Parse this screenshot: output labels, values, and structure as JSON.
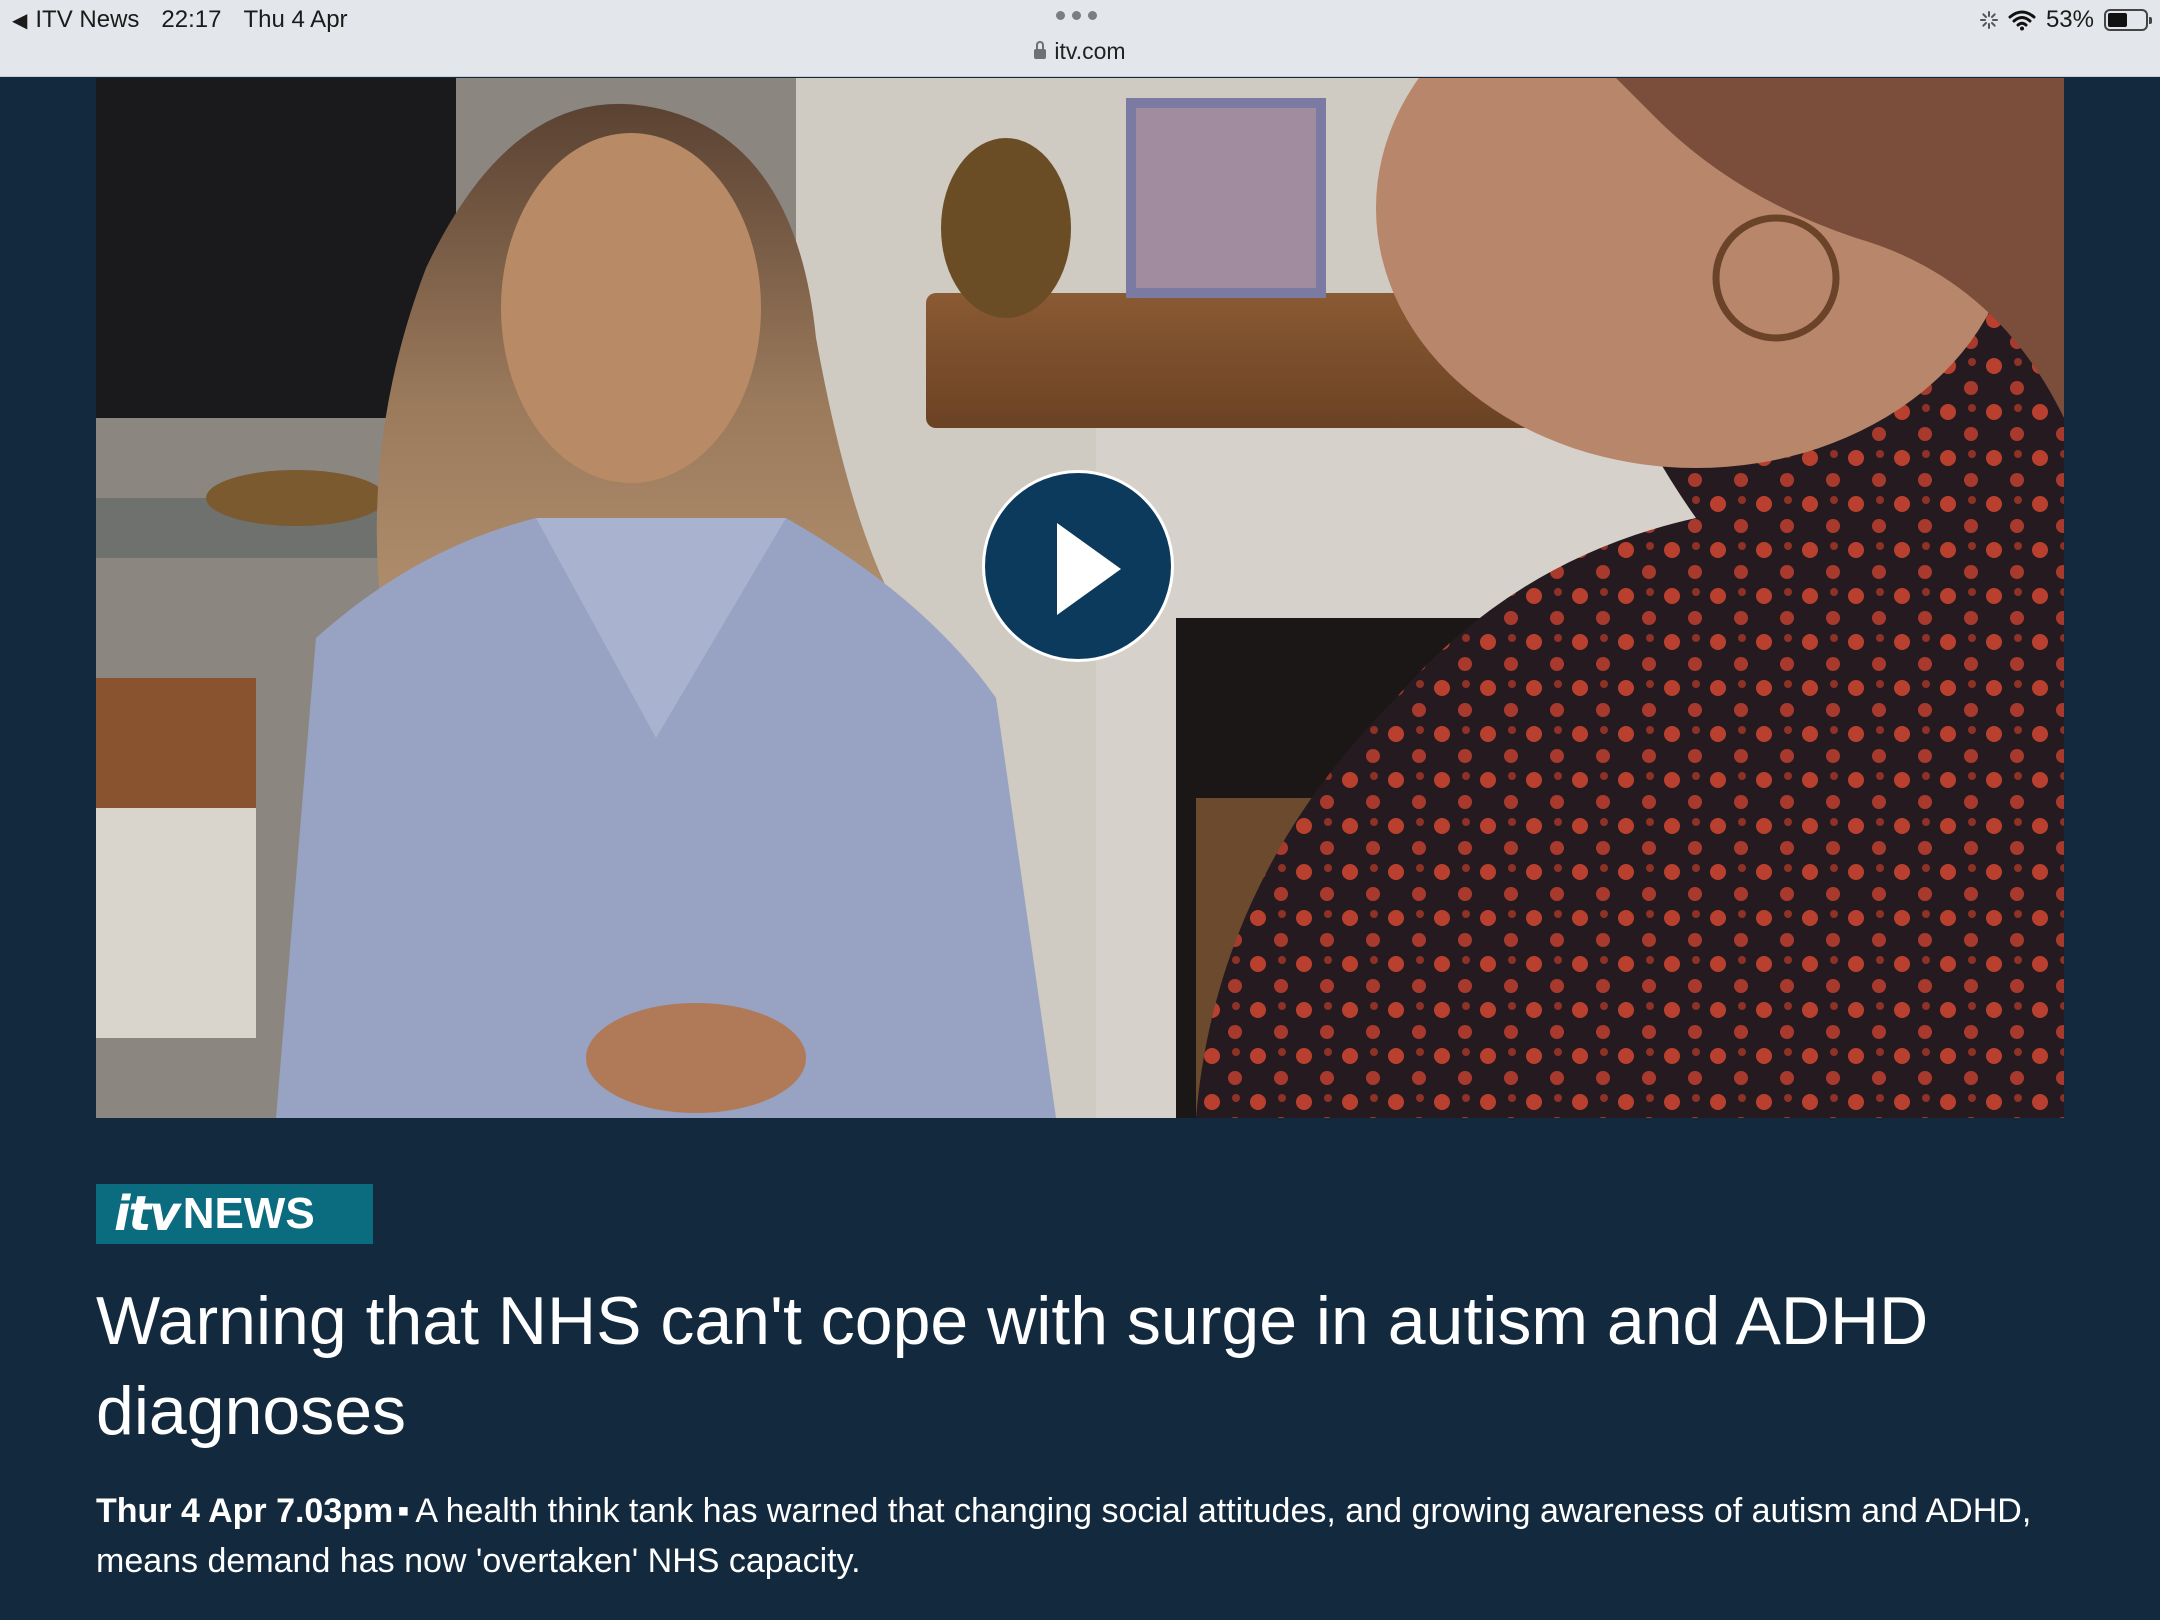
{
  "status_bar": {
    "back_app": "ITV News",
    "time": "22:17",
    "date": "Thu 4 Apr",
    "url": "itv.com",
    "battery": "53%",
    "battery_level": 0.53
  },
  "video": {
    "play_icon": "play-icon"
  },
  "brand": {
    "logo_itv": "itv",
    "logo_news": "NEWS",
    "color": "#0b6b7f"
  },
  "article": {
    "headline": "Warning that NHS can't cope with surge in autism and ADHD diagnoses",
    "published": "Thur 4 Apr 7.03pm",
    "separator": "▪",
    "summary": "A health think tank has warned that changing social attitudes, and growing awareness of autism and ADHD, means demand has now 'overtaken' NHS capacity."
  },
  "colors": {
    "page_background": "#132a3e",
    "play_button": "#0c3a5c"
  }
}
